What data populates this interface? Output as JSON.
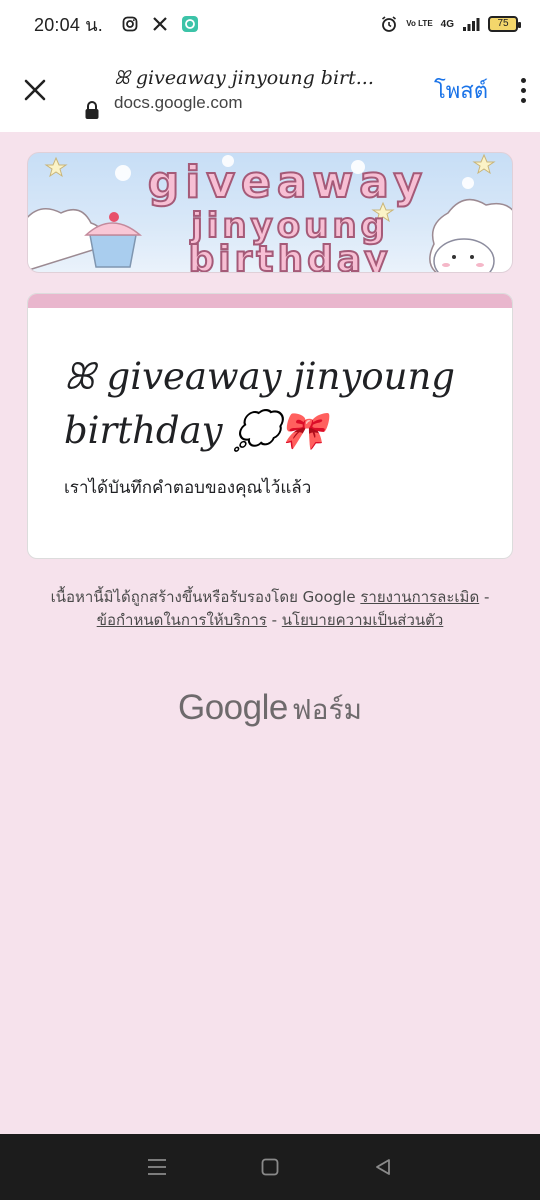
{
  "status_bar": {
    "time": "20:04 น.",
    "battery_level": "75",
    "network": "4G",
    "volte": "Vo LTE",
    "icons": [
      "instagram-icon",
      "x-icon",
      "app-icon",
      "alarm-icon",
      "signal-icon",
      "battery-icon"
    ]
  },
  "browser": {
    "page_title": "ꕤ giveaway jinyoung birt...",
    "url": "docs.google.com",
    "post_label": "โพสต์",
    "icons": [
      "close-icon",
      "lock-icon",
      "more-vert-icon"
    ],
    "accent_color": "#1a73e8"
  },
  "banner": {
    "line1": "giveaway",
    "line2": "jinyoung",
    "line3": "birthday"
  },
  "form": {
    "title": "ꕤ giveaway jinyoung birthday 💭🎀",
    "confirmation": "เราได้บันทึกคำตอบของคุณไว้แล้ว",
    "header_color": "#e9b6cd",
    "background_color": "#f6e2ec"
  },
  "footer": {
    "disclaimer": "เนื้อหานี้มิได้ถูกสร้างขึ้นหรือรับรองโดย Google",
    "report_link": "รายงานการละเมิด",
    "sep1": " - ",
    "terms_link": "ข้อกำหนดในการให้บริการ",
    "sep2": " - ",
    "privacy_link": "นโยบายความเป็นส่วนตัว",
    "brand_google": "Google",
    "brand_forms": "ฟอร์ม"
  },
  "nav": {
    "icons": [
      "recents-icon",
      "home-icon",
      "back-icon"
    ]
  }
}
